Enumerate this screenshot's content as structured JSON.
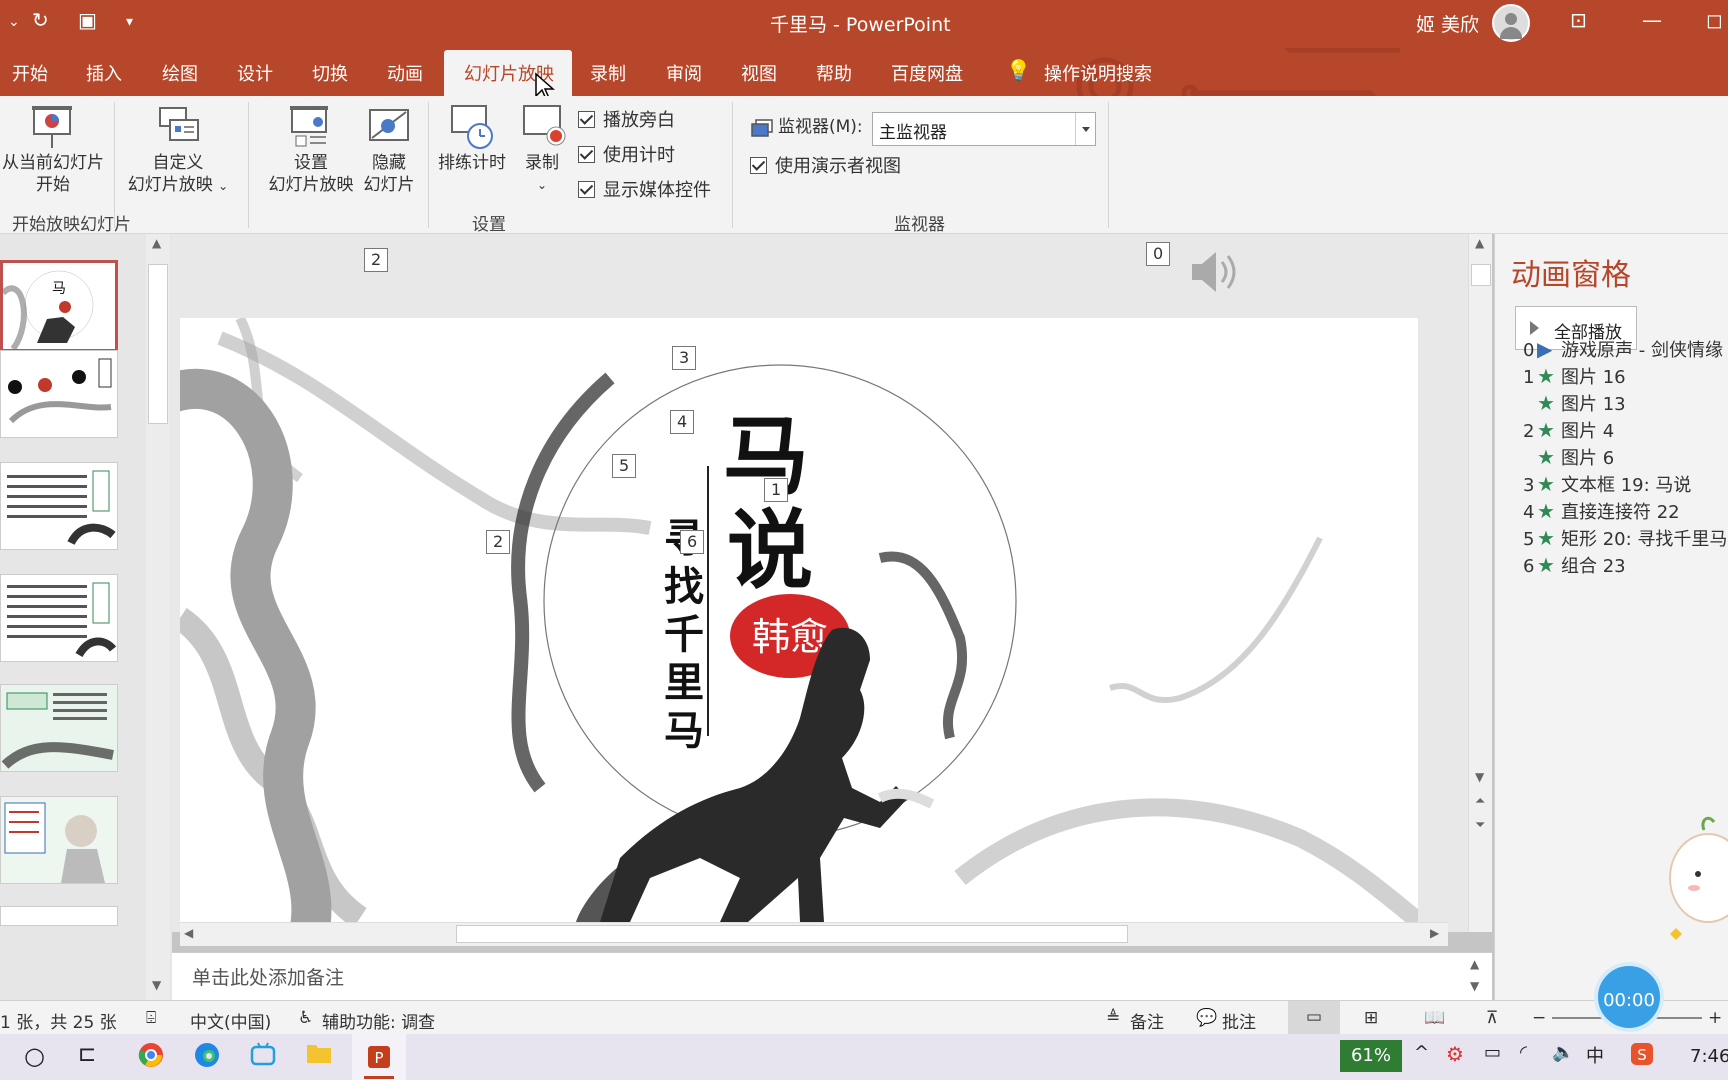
{
  "title_bar": {
    "doc_title": "千里马  -  PowerPoint",
    "user_name": "姬 美欣"
  },
  "tabs": [
    "开始",
    "插入",
    "绘图",
    "设计",
    "切换",
    "动画",
    "幻灯片放映",
    "录制",
    "审阅",
    "视图",
    "帮助",
    "百度网盘"
  ],
  "active_tab": "幻灯片放映",
  "search_label": "操作说明搜索",
  "ribbon": {
    "from_current_line1": "从当前幻灯片",
    "from_current_line2": "开始",
    "custom_line1": "自定义",
    "custom_line2": "幻灯片放映",
    "setup_line1": "设置",
    "setup_line2": "幻灯片放映",
    "hide_line1": "隐藏",
    "hide_line2": "幻灯片",
    "rehearse": "排练计时",
    "record": "录制",
    "play_narration": "播放旁白",
    "use_timings": "使用计时",
    "show_media_controls": "显示媒体控件",
    "monitor_label": "监视器(M):",
    "monitor_value": "主监视器",
    "presenter_view": "使用演示者视图",
    "group_start": "开始放映幻灯片",
    "group_setup": "设置",
    "group_monitors": "监视器"
  },
  "slide": {
    "title": "马说",
    "author": "韩愈",
    "subtitle": "寻找千里马",
    "anim_tags": [
      "2",
      "0",
      "3",
      "4",
      "5",
      "2",
      "6",
      "1"
    ]
  },
  "notes_placeholder": "单击此处添加备注",
  "anim_pane": {
    "title": "动画窗格",
    "play_all": "全部播放",
    "items": [
      {
        "num": "0",
        "icon": "play",
        "label": "游戏原声 - 剑侠情缘"
      },
      {
        "num": "1",
        "icon": "star",
        "label": "图片 16"
      },
      {
        "num": "",
        "icon": "star",
        "label": "图片 13"
      },
      {
        "num": "2",
        "icon": "star",
        "label": "图片 4"
      },
      {
        "num": "",
        "icon": "star",
        "label": "图片 6"
      },
      {
        "num": "3",
        "icon": "star",
        "label": "文本框 19: 马说"
      },
      {
        "num": "4",
        "icon": "star",
        "label": "直接连接符 22"
      },
      {
        "num": "5",
        "icon": "star",
        "label": "矩形 20: 寻找千里马"
      },
      {
        "num": "6",
        "icon": "star",
        "label": "组合 23"
      }
    ]
  },
  "status": {
    "slide_count": "1 张，共 25 张",
    "language": "中文(中国)",
    "accessibility": "辅助功能: 调查",
    "notes_btn": "备注",
    "comments_btn": "批注"
  },
  "timer": "00:00",
  "taskbar": {
    "battery": "61%",
    "clock": "7:46"
  },
  "colors": {
    "accent": "#b7472a",
    "anim_title": "#b7472a",
    "star": "#2f8a56"
  }
}
